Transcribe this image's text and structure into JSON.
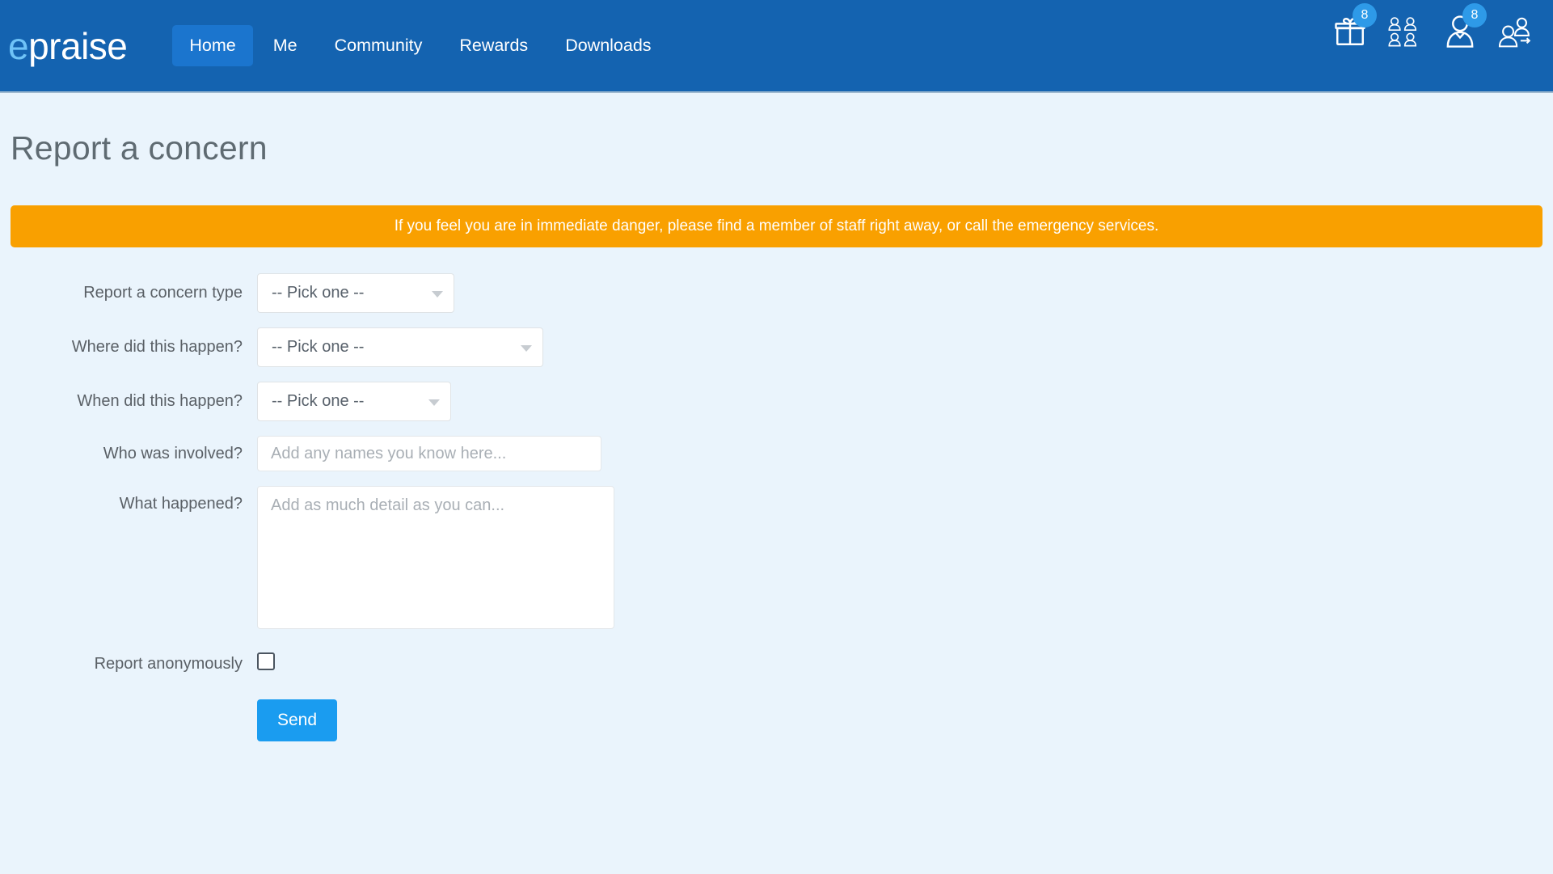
{
  "brand": {
    "logo_prefix": "e",
    "logo_rest": "praise",
    "accent_color": "#6fc3f7",
    "navbar_color": "#1463b0",
    "active_tab_color": "#1b75ce"
  },
  "nav": {
    "items": [
      {
        "label": "Home",
        "active": true
      },
      {
        "label": "Me",
        "active": false
      },
      {
        "label": "Community",
        "active": false
      },
      {
        "label": "Rewards",
        "active": false
      },
      {
        "label": "Downloads",
        "active": false
      }
    ],
    "icons": [
      {
        "name": "gift-icon",
        "badge": "8"
      },
      {
        "name": "group-people-icon",
        "badge": ""
      },
      {
        "name": "person-icon",
        "badge": "8"
      },
      {
        "name": "person-swap-icon",
        "badge": ""
      }
    ]
  },
  "page": {
    "title": "Report a concern"
  },
  "alert": {
    "text": "If you feel you are in immediate danger, please find a member of staff right away, or call the emergency services.",
    "background_color": "#f9a000"
  },
  "form": {
    "concern_type": {
      "label": "Report a concern type",
      "value": "-- Pick one --"
    },
    "where": {
      "label": "Where did this happen?",
      "value": "-- Pick one --"
    },
    "when": {
      "label": "When did this happen?",
      "value": "-- Pick one --"
    },
    "who": {
      "label": "Who was involved?",
      "placeholder": "Add any names you know here...",
      "value": ""
    },
    "what": {
      "label": "What happened?",
      "placeholder": "Add as much detail as you can...",
      "value": ""
    },
    "anonymous": {
      "label": "Report anonymously",
      "checked": false
    },
    "submit": {
      "label": "Send",
      "color": "#1a9cf0"
    }
  }
}
